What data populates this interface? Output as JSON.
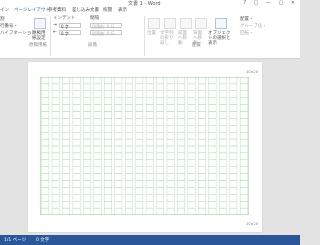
{
  "window": {
    "title": "文書 1 - Word",
    "controls": "? ▢ — ▢ ✕"
  },
  "tabs": [
    {
      "label": "イン"
    },
    {
      "label": "ページレイアウト"
    },
    {
      "label": "参考資料"
    },
    {
      "label": "差し込み文書"
    },
    {
      "label": "校閲"
    },
    {
      "label": "表示"
    }
  ],
  "ribbon": {
    "left_items": [
      "割",
      "行番号・",
      "ハイフネーション・"
    ],
    "manuscript_button": "原稿用紙設定",
    "manuscript_group": "原稿用紙",
    "indent_header": "インデント",
    "indent_left": "0 字",
    "indent_right": "0 字",
    "spacing_header": "間隔",
    "spacing_before": "段落前: 0 行",
    "spacing_after": "段落後: 0 行",
    "paragraph_group": "段落",
    "arrange_items": [
      "位置",
      "文字列の折り返し",
      "前面へ移動",
      "背面へ移動",
      "オブジェクトの選択と表示"
    ],
    "arrange_right": [
      "配置・",
      "グループ化・",
      "回転・"
    ],
    "arrange_group": "配置"
  },
  "document": {
    "page_corner_top": "20×20",
    "page_corner_bottom": "20×20"
  },
  "status": {
    "page": "1/1 ページ",
    "words": "0 文字"
  },
  "colors": {
    "accent": "#2b579a",
    "grid": "#9ed49e"
  }
}
